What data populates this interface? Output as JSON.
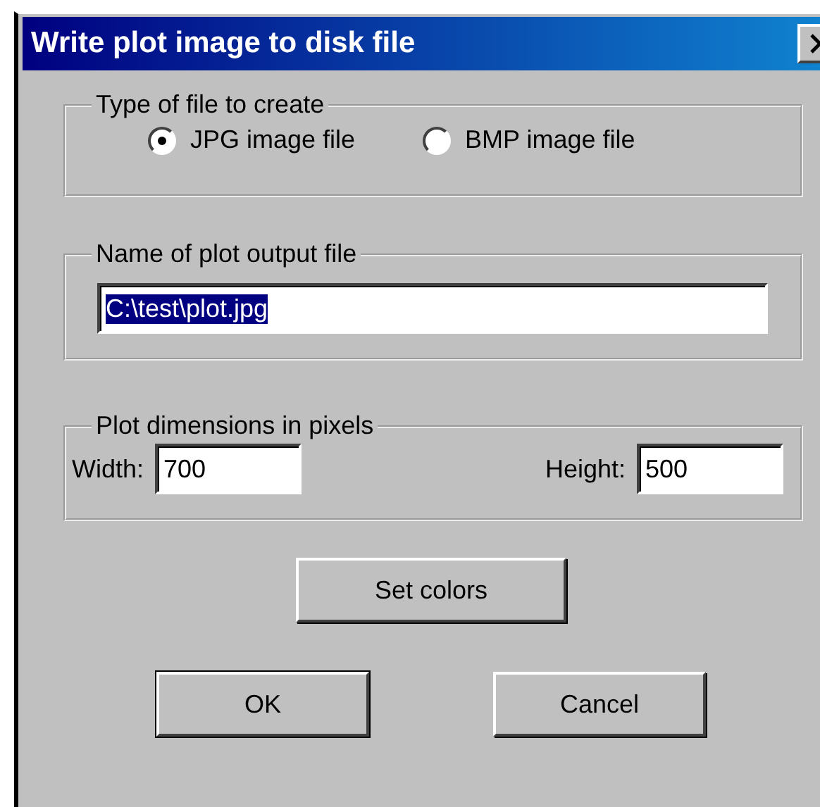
{
  "window": {
    "title": "Write plot image to disk file"
  },
  "file_type": {
    "label": "Type of file to create",
    "options": [
      {
        "label": "JPG image file",
        "selected": true
      },
      {
        "label": "BMP image file",
        "selected": false
      }
    ]
  },
  "output_file": {
    "label": "Name of plot output file",
    "value": "C:\\test\\plot.jpg",
    "text_selected": true
  },
  "dimensions": {
    "label": "Plot dimensions in pixels",
    "fields": [
      {
        "label": "Width:",
        "value": "700"
      },
      {
        "label": "Height:",
        "value": "500"
      }
    ]
  },
  "set_colors_button": "Set colors",
  "buttons": [
    {
      "label": "OK",
      "default": true
    },
    {
      "label": "Cancel",
      "default": false
    }
  ]
}
